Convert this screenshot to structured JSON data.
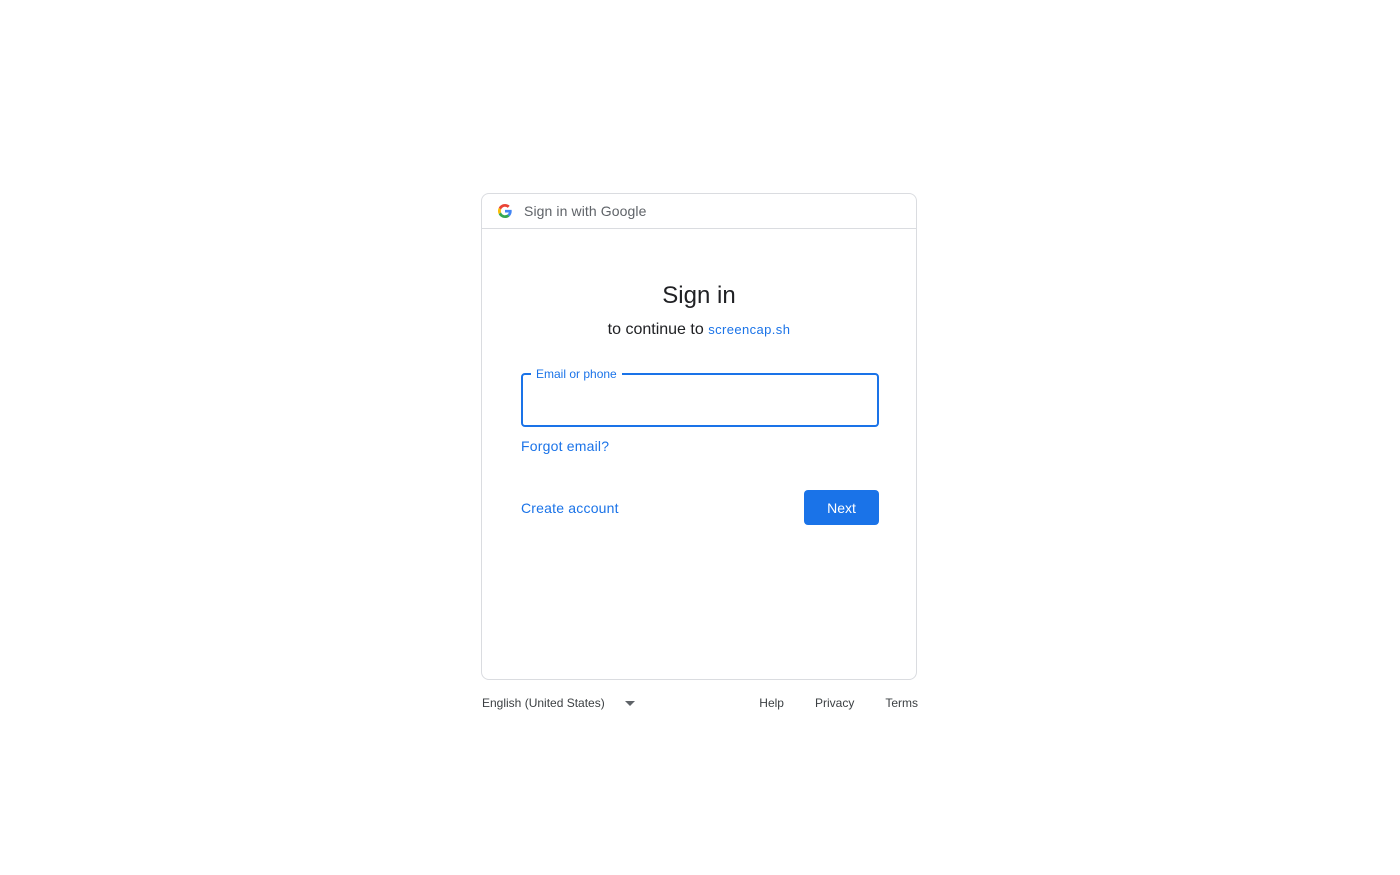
{
  "header": {
    "text": "Sign in with Google"
  },
  "main": {
    "title": "Sign in",
    "subtitle_prefix": "to continue to",
    "subtitle_link": "screencap.sh",
    "email_field": {
      "label": "Email or phone",
      "value": ""
    },
    "forgot_email": "Forgot email?",
    "create_account": "Create account",
    "next_label": "Next"
  },
  "footer": {
    "language": "English (United States)",
    "links": [
      "Help",
      "Privacy",
      "Terms"
    ]
  },
  "colors": {
    "accent": "#1a73e8",
    "border": "#dadce0"
  }
}
